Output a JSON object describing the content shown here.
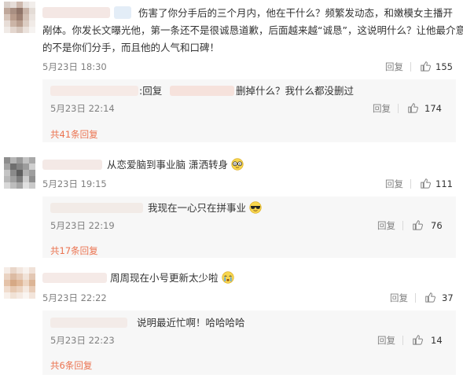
{
  "comments": [
    {
      "text_line1": "伤害了你分手后的三个月内，他在干什么？频繁发动态，和嫩模女主播开",
      "text_line2": "剐体。你发长文曝光他，第一条还不是很诚恳道歉，后面越来越“诚恳”，这说明什么？让他最介意",
      "text_line3": "的不是你们分手，而且他的人气和口碑！",
      "time": "5月23日 18:30",
      "reply_label": "回复",
      "likes": "155",
      "sub_reply": {
        "prefix": ":回复",
        "text": "删掉什么？我什么都没删过",
        "time": "5月23日 22:14",
        "reply_label": "回复",
        "likes": "174"
      },
      "more_link": "共41条回复"
    },
    {
      "text": "从恋爱脑到事业脑 潇洒转身",
      "emoji": "glasses-emoji",
      "time": "5月23日 19:15",
      "reply_label": "回复",
      "likes": "111",
      "sub_reply": {
        "text": "我现在一心只在拼事业",
        "emoji": "sunglasses-emoji",
        "time": "5月23日 22:19",
        "reply_label": "回复",
        "likes": "76"
      },
      "more_link": "共17条回复"
    },
    {
      "text": "周周现在小号更新太少啦",
      "emoji": "crying-emoji",
      "time": "5月23日 22:22",
      "reply_label": "回复",
      "likes": "37",
      "sub_reply": {
        "text": "说明最近忙啊！哈哈哈哈",
        "time": "5月23日 22:23",
        "reply_label": "回复",
        "likes": "14"
      },
      "more_link": "共6条回复"
    }
  ],
  "colors": {
    "link": "#eb7350",
    "meta": "#808080",
    "reply_bg": "#f7f7f7"
  }
}
